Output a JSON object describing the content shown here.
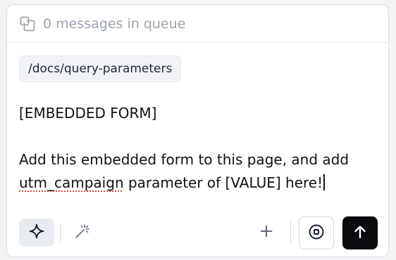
{
  "queue": {
    "icon": "copy-queue-icon",
    "status": "0 messages in queue"
  },
  "context": {
    "path": "/docs/query-parameters"
  },
  "editor": {
    "line1": "[EMBEDDED FORM]",
    "line2": "Add this embedded form to this page, and add",
    "line3_word": "utm_campaign",
    "line3_rest": " parameter of [VALUE] here!"
  },
  "toolbar": {
    "sparkle_icon": "sparkle-icon",
    "magic_icon": "magic-wand-icon",
    "plus_icon": "plus-icon",
    "stop_icon": "stop-icon",
    "send_icon": "arrow-up-icon"
  },
  "colors": {
    "send_button_bg": "#0b0b0f",
    "sparkle_button_bg": "#e8ecf2",
    "spellcheck_underline": "#e0464b"
  }
}
